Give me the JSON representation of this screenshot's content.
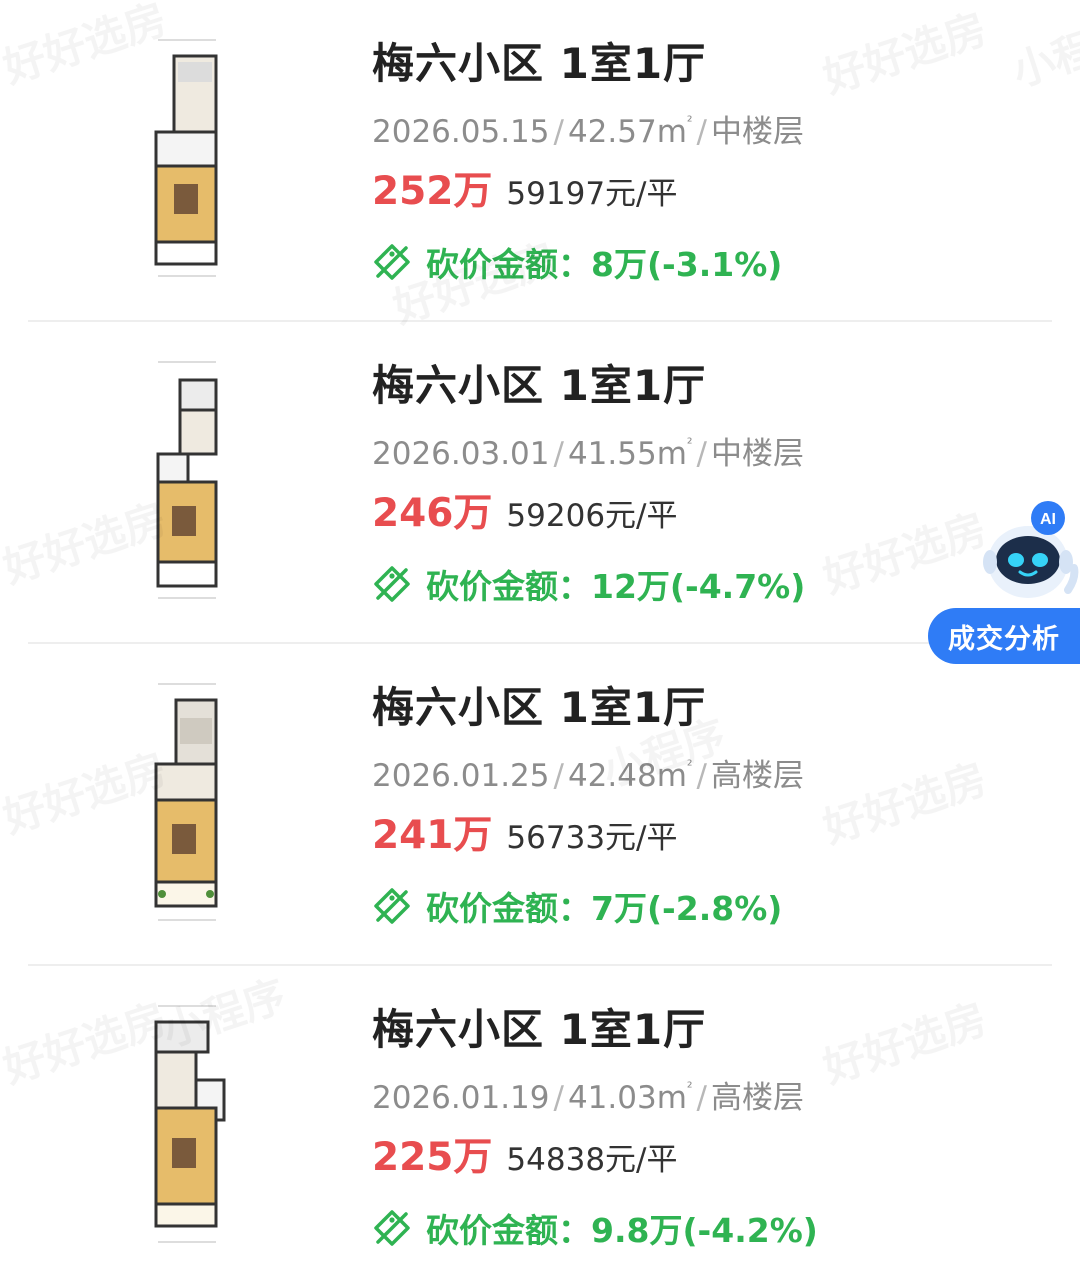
{
  "listings": [
    {
      "title": "梅六小区 1室1厅",
      "date": "2026.05.15",
      "area": "42.57m",
      "area_unit_sup": "²",
      "floor": "中楼层",
      "total_price": "252万",
      "unit_price": "59197元/平",
      "cut_label": "砍价金额：",
      "cut_amount": "8万(-3.1%)"
    },
    {
      "title": "梅六小区 1室1厅",
      "date": "2026.03.01",
      "area": "41.55m",
      "area_unit_sup": "²",
      "floor": "中楼层",
      "total_price": "246万",
      "unit_price": "59206元/平",
      "cut_label": "砍价金额：",
      "cut_amount": "12万(-4.7%)"
    },
    {
      "title": "梅六小区 1室1厅",
      "date": "2026.01.25",
      "area": "42.48m",
      "area_unit_sup": "²",
      "floor": "高楼层",
      "total_price": "241万",
      "unit_price": "56733元/平",
      "cut_label": "砍价金额：",
      "cut_amount": "7万(-2.8%)"
    },
    {
      "title": "梅六小区 1室1厅",
      "date": "2026.01.19",
      "area": "41.03m",
      "area_unit_sup": "²",
      "floor": "高楼层",
      "total_price": "225万",
      "unit_price": "54838元/平",
      "cut_label": "砍价金额：",
      "cut_amount": "9.8万(-4.2%)"
    }
  ],
  "separator": "/",
  "watermark": {
    "brand": "好好选房",
    "sub": "小程序"
  },
  "ai_fab": {
    "badge": "AI",
    "label": "成交分析"
  },
  "colors": {
    "price_red": "#e84d4f",
    "cut_green": "#2fb352",
    "fab_blue": "#2f7cf6"
  }
}
